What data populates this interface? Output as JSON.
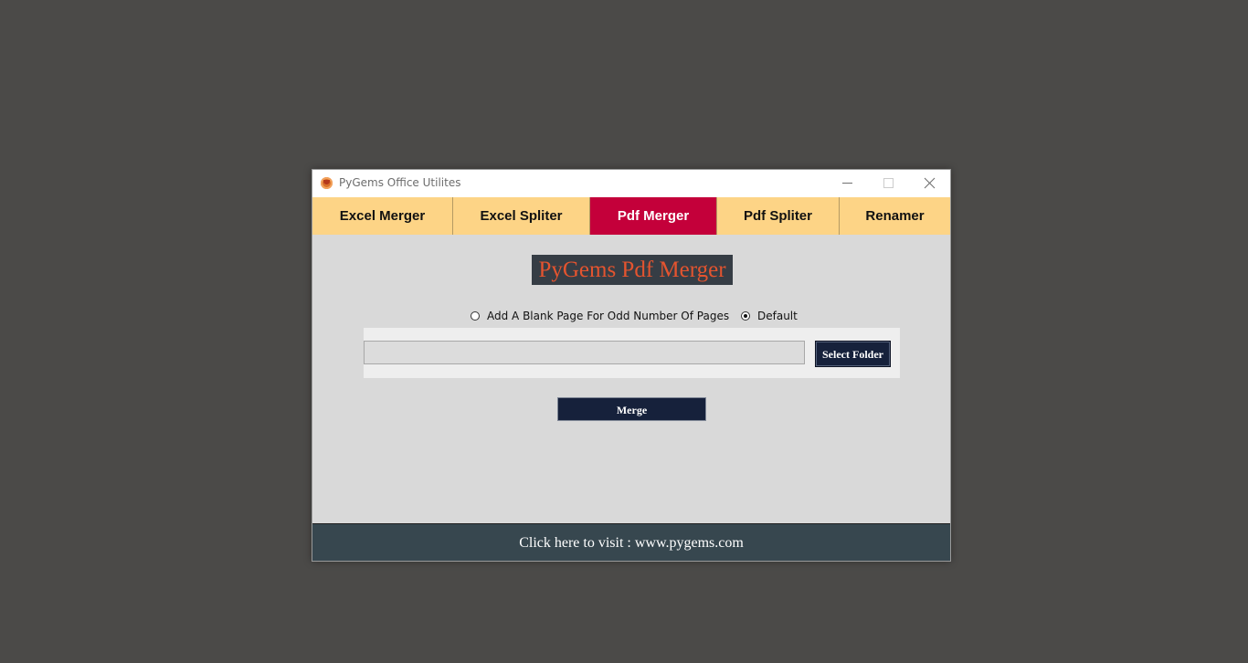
{
  "window": {
    "title": "PyGems Office Utilites"
  },
  "tabs": [
    {
      "label": "Excel Merger",
      "active": false
    },
    {
      "label": "Excel Spliter",
      "active": false
    },
    {
      "label": "Pdf Merger",
      "active": true
    },
    {
      "label": "Pdf Spliter",
      "active": false
    },
    {
      "label": "Renamer",
      "active": false
    }
  ],
  "main": {
    "heading": "PyGems Pdf Merger",
    "options": [
      {
        "label": "Add A Blank Page For Odd Number Of Pages",
        "checked": false
      },
      {
        "label": "Default",
        "checked": true
      }
    ],
    "folder_input_value": "",
    "select_folder_label": "Select Folder",
    "merge_label": "Merge"
  },
  "footer": {
    "link_text": "Click here to visit : www.pygems.com"
  },
  "colors": {
    "tab_inactive": "#fdd486",
    "tab_active": "#c4003a",
    "heading_text": "#e4542f",
    "heading_bg": "#363d45",
    "button_bg": "#16213b",
    "footer_bg": "#37474f"
  },
  "icons": {
    "app": "pygems-logo-icon",
    "minimize": "minimize-icon",
    "maximize": "maximize-icon",
    "close": "close-icon"
  }
}
